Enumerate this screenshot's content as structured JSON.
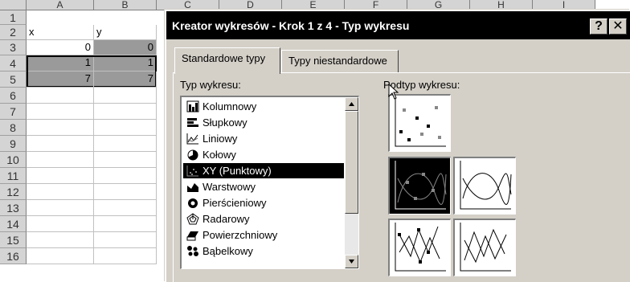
{
  "spreadsheet": {
    "columns": [
      "A",
      "B",
      "C",
      "D",
      "E",
      "F",
      "G",
      "H",
      "I"
    ],
    "rows": [
      "1",
      "2",
      "3",
      "4",
      "5",
      "6",
      "7",
      "8",
      "9",
      "10",
      "11",
      "12",
      "13",
      "14",
      "15",
      "16"
    ],
    "cells": {
      "A1": "x",
      "B1": "y",
      "A2": "0",
      "B2": "0",
      "A3": "1",
      "B3": "1",
      "A4": "7",
      "B4": "7"
    }
  },
  "dialog": {
    "title": "Kreator wykresów - Krok 1 z 4 - Typ wykresu",
    "help_label": "?",
    "close_label": "✕",
    "tabs": [
      {
        "label": "Standardowe typy",
        "active": true
      },
      {
        "label": "Typy niestandardowe",
        "active": false
      }
    ],
    "chart_type_label": "Typ wykresu:",
    "subtype_label": "Podtyp wykresu:",
    "chart_types": [
      {
        "label": "Kolumnowy",
        "icon": "column-chart-icon"
      },
      {
        "label": "Słupkowy",
        "icon": "bar-chart-icon"
      },
      {
        "label": "Liniowy",
        "icon": "line-chart-icon"
      },
      {
        "label": "Kołowy",
        "icon": "pie-chart-icon"
      },
      {
        "label": "XY (Punktowy)",
        "icon": "scatter-chart-icon",
        "selected": true
      },
      {
        "label": "Warstwowy",
        "icon": "area-chart-icon"
      },
      {
        "label": "Pierścieniowy",
        "icon": "doughnut-chart-icon"
      },
      {
        "label": "Radarowy",
        "icon": "radar-chart-icon"
      },
      {
        "label": "Powierzchniowy",
        "icon": "surface-chart-icon"
      },
      {
        "label": "Bąbelkowy",
        "icon": "bubble-chart-icon"
      }
    ],
    "subtypes": [
      {
        "icon": "scatter-markers-icon"
      },
      {
        "icon": "scatter-smooth-markers-icon",
        "selected": true
      },
      {
        "icon": "scatter-smooth-lines-icon"
      },
      {
        "icon": "scatter-straight-markers-icon"
      },
      {
        "icon": "scatter-straight-lines-icon"
      }
    ]
  }
}
